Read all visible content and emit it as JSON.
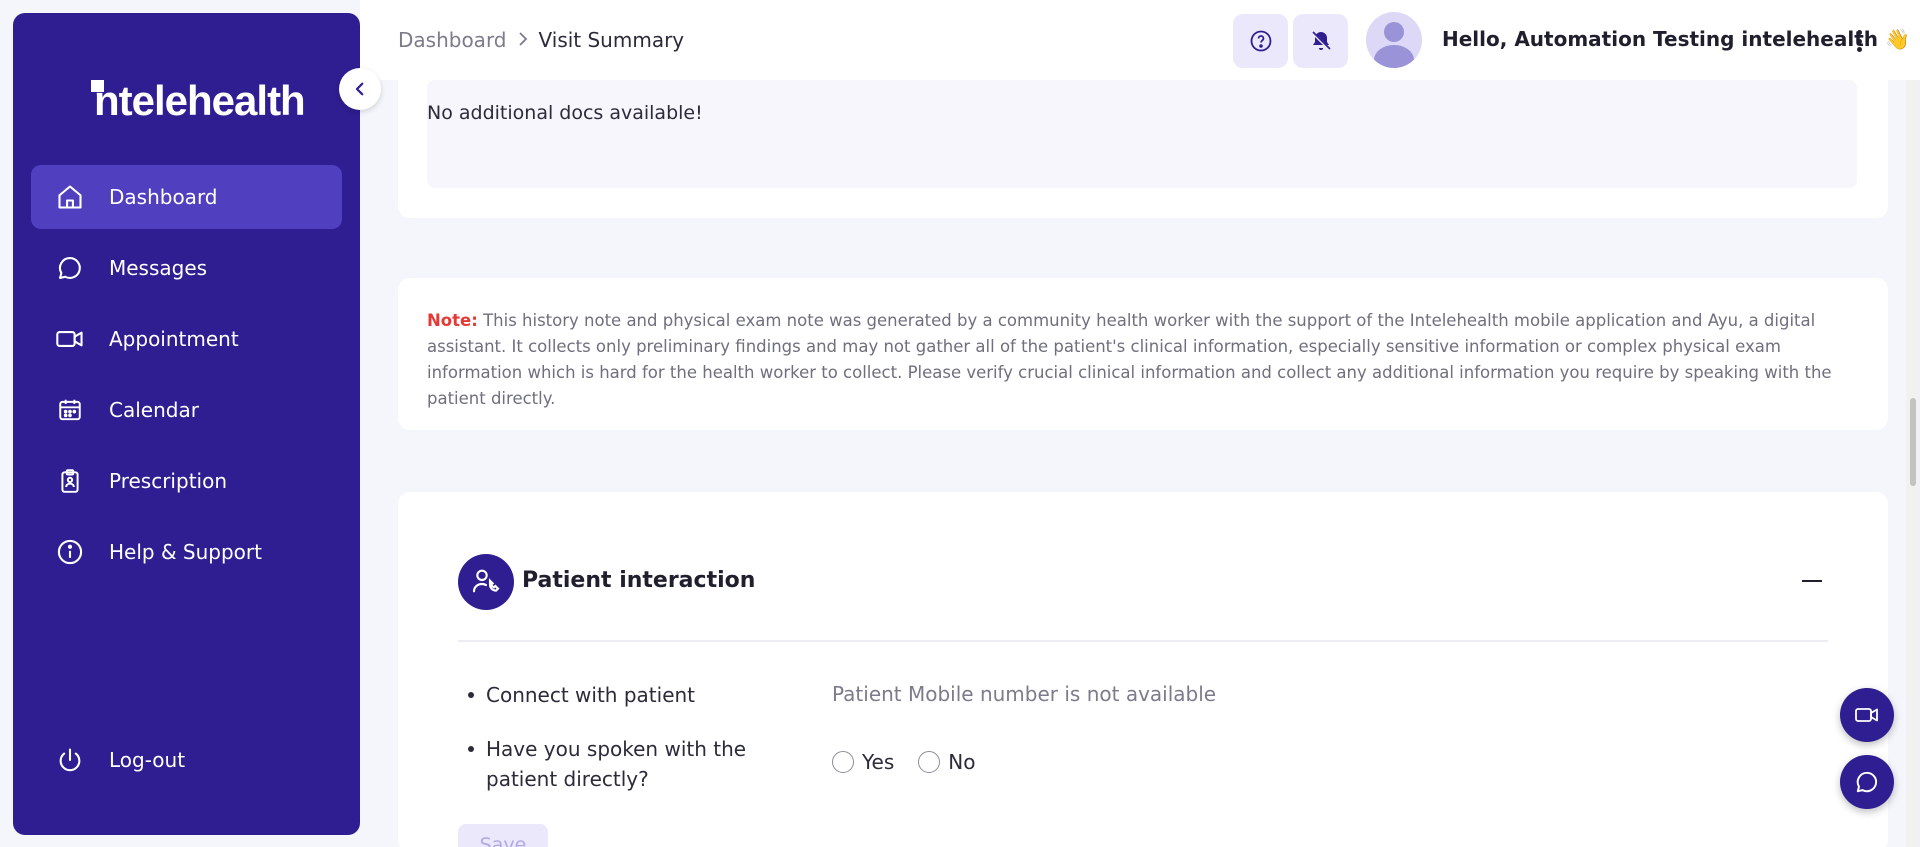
{
  "sidebar": {
    "logo": "intelehealth",
    "items": [
      {
        "label": "Dashboard"
      },
      {
        "label": "Messages"
      },
      {
        "label": "Appointment"
      },
      {
        "label": "Calendar"
      },
      {
        "label": "Prescription"
      },
      {
        "label": "Help & Support"
      }
    ],
    "logout_label": "Log-out"
  },
  "header": {
    "breadcrumb": [
      "Dashboard",
      "Visit Summary"
    ],
    "greeting": "Hello, Automation Testing intelehealth",
    "greeting_emoji": "👋"
  },
  "docs": {
    "text": "No additional docs available!"
  },
  "note": {
    "label": "Note:",
    "text": " This history note and physical exam note was generated by a community health worker with the support of the Intelehealth mobile application and Ayu, a digital assistant. It collects only preliminary findings and may not gather all of the patient's clinical information, especially sensitive information or complex physical exam information which is hard for the health worker to collect. Please verify crucial clinical information and collect any additional information you require by speaking with the patient directly."
  },
  "patient_interaction": {
    "title": "Patient interaction",
    "connect_label": "Connect with patient",
    "connect_value": "Patient Mobile number is not available",
    "spoken_label_line1": "Have you spoken with the",
    "spoken_label_line2": "patient directly?",
    "options": [
      "Yes",
      "No"
    ],
    "save_label": "Save"
  },
  "colors": {
    "brand": "#2e1e91",
    "active_nav": "#5040c0",
    "note_label": "#e53935"
  }
}
